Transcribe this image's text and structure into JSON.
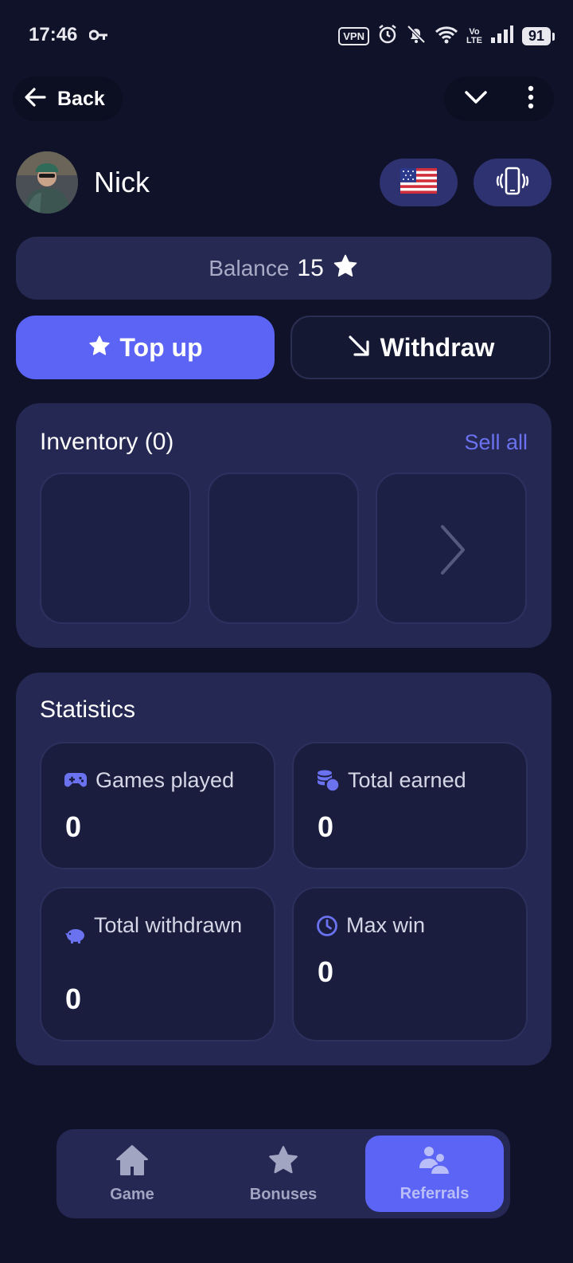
{
  "status_bar": {
    "time": "17:46",
    "vpn": "VPN",
    "volte_top": "Vo",
    "volte_bottom": "LTE",
    "battery": "91"
  },
  "nav": {
    "back_label": "Back"
  },
  "profile": {
    "name": "Nick"
  },
  "balance": {
    "label": "Balance",
    "value": "15"
  },
  "actions": {
    "topup_label": "Top up",
    "withdraw_label": "Withdraw"
  },
  "inventory": {
    "title": "Inventory (0)",
    "sell_all": "Sell all"
  },
  "statistics": {
    "title": "Statistics",
    "items": [
      {
        "label": "Games played",
        "value": "0",
        "icon": "gamepad-icon"
      },
      {
        "label": "Total earned",
        "value": "0",
        "icon": "coins-icon"
      },
      {
        "label": "Total withdrawn",
        "value": "0",
        "icon": "piggy-bank-icon"
      },
      {
        "label": "Max win",
        "value": "0",
        "icon": "clock-icon"
      }
    ]
  },
  "bottom_nav": {
    "items": [
      {
        "label": "Game",
        "icon": "home-icon"
      },
      {
        "label": "Bonuses",
        "icon": "star-icon"
      },
      {
        "label": "Referrals",
        "icon": "users-icon"
      }
    ],
    "active": "Referrals"
  },
  "colors": {
    "background": "#10122a",
    "card": "#252852",
    "accent": "#5b64f5",
    "link": "#6a72f0"
  }
}
